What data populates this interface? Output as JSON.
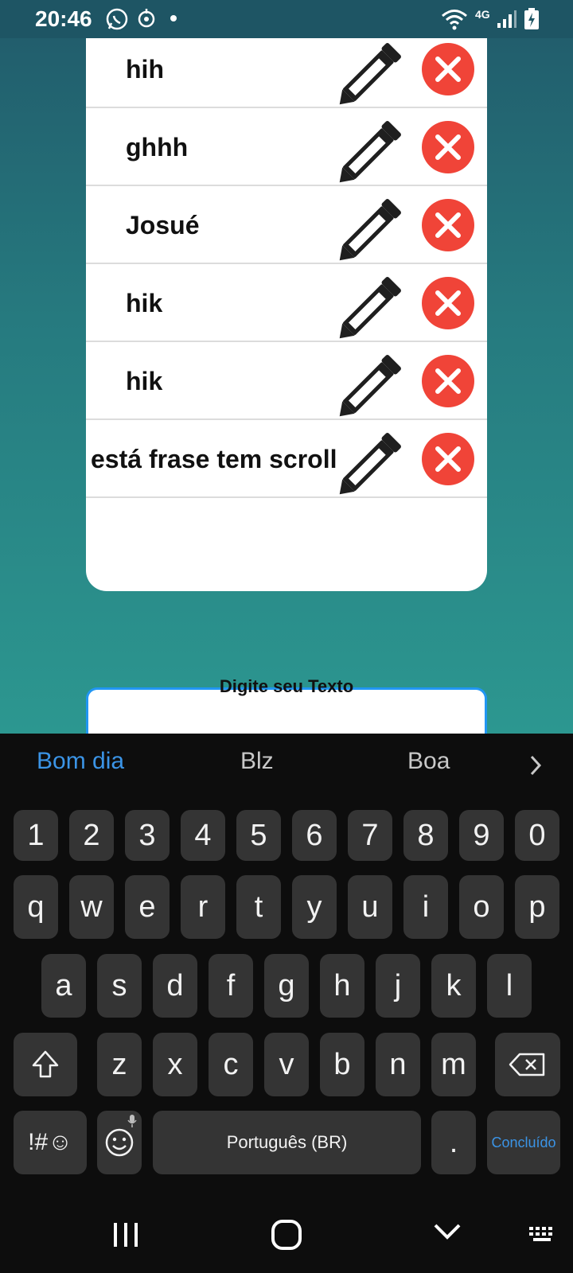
{
  "status_bar": {
    "time": "20:46",
    "network": "4G"
  },
  "list": {
    "items": [
      {
        "label": "hih"
      },
      {
        "label": "ghhh"
      },
      {
        "label": "Josué"
      },
      {
        "label": "hik"
      },
      {
        "label": "hik"
      },
      {
        "label": "está frase tem scroll"
      }
    ]
  },
  "input": {
    "label": "Digite seu Texto",
    "value": ""
  },
  "keyboard": {
    "suggestions": [
      "Bom dia",
      "Blz",
      "Boa"
    ],
    "number_row": [
      "1",
      "2",
      "3",
      "4",
      "5",
      "6",
      "7",
      "8",
      "9",
      "0"
    ],
    "row1": [
      "q",
      "w",
      "e",
      "r",
      "t",
      "y",
      "u",
      "i",
      "o",
      "p"
    ],
    "row2": [
      "a",
      "s",
      "d",
      "f",
      "g",
      "h",
      "j",
      "k",
      "l"
    ],
    "row3": [
      "z",
      "x",
      "c",
      "v",
      "b",
      "n",
      "m"
    ],
    "symbols_label": "!#☺",
    "space_label": "Português (BR)",
    "period_label": ".",
    "done_label": "Concluído"
  },
  "colors": {
    "accent_blue": "#2196f3",
    "delete_red": "#f04438",
    "keyboard_bg": "#0d0d0d",
    "key_bg": "#343434",
    "suggestion_primary": "#3b94e6"
  },
  "icons": {
    "edit": "pencil-icon",
    "delete": "close-circle-icon",
    "shift": "shift-icon",
    "backspace": "backspace-icon",
    "emoji": "emoji-icon",
    "mic": "mic-icon"
  }
}
